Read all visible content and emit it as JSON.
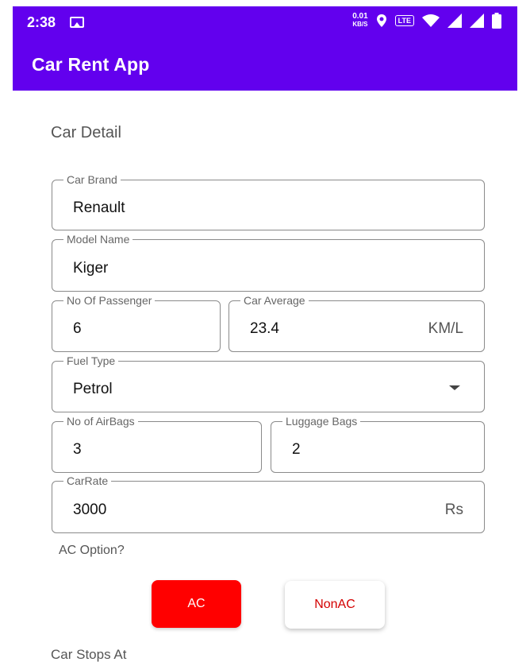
{
  "status_bar": {
    "time": "2:38",
    "speed_value": "0.01",
    "speed_unit": "KB/S",
    "lte": "LTE"
  },
  "app_bar": {
    "title": "Car Rent App"
  },
  "section": {
    "title": "Car Detail"
  },
  "fields": {
    "car_brand": {
      "label": "Car Brand",
      "value": "Renault"
    },
    "model_name": {
      "label": "Model Name",
      "value": "Kiger"
    },
    "passengers": {
      "label": "No Of Passenger",
      "value": "6"
    },
    "car_average": {
      "label": "Car Average",
      "value": "23.4",
      "suffix": "KM/L"
    },
    "fuel_type": {
      "label": "Fuel Type",
      "value": "Petrol"
    },
    "airbags": {
      "label": "No of AirBags",
      "value": "3"
    },
    "luggage": {
      "label": "Luggage Bags",
      "value": "2"
    },
    "car_rate": {
      "label": "CarRate",
      "value": "3000",
      "suffix": "Rs"
    }
  },
  "ac_option": {
    "label": "AC Option?",
    "ac_button": "AC",
    "nonac_button": "NonAC"
  },
  "stops": {
    "label": "Car Stops At"
  },
  "colors": {
    "primary": "#6200ee",
    "ac_selected": "#ff0000",
    "nonac_text": "#d40000"
  }
}
